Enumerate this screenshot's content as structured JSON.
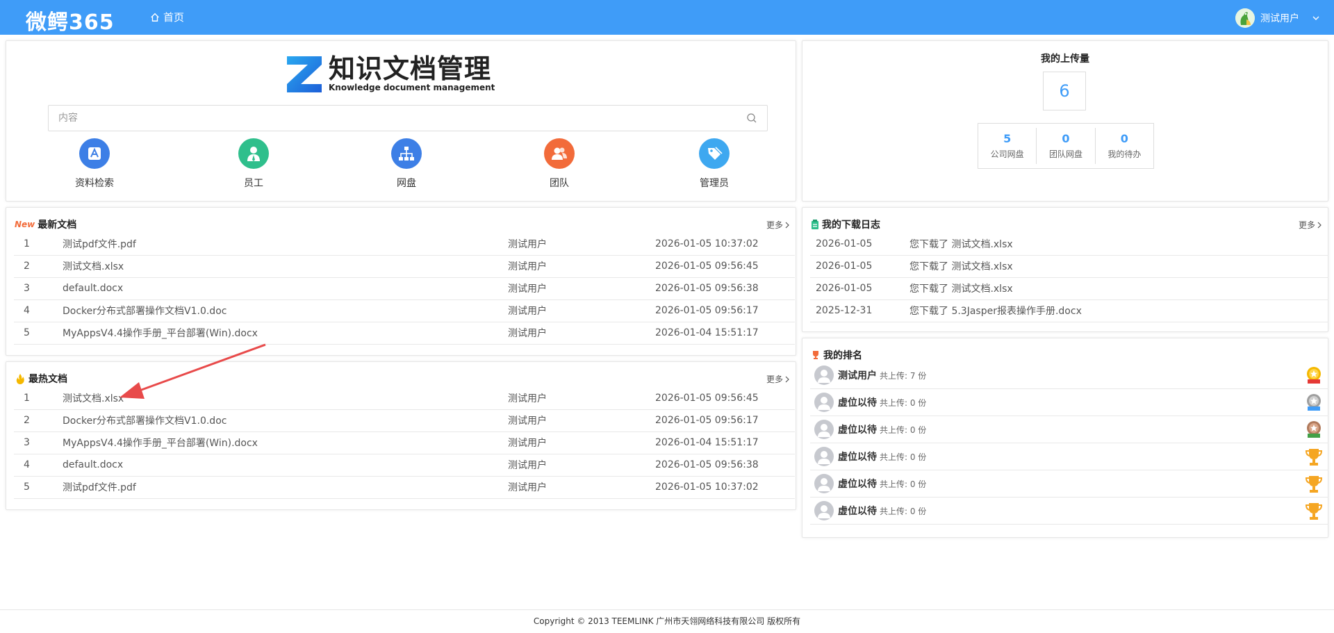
{
  "topbar": {
    "brand": "微鳄365",
    "home_label": "首页",
    "user_name": "测试用户"
  },
  "hero": {
    "logo_cn": "知识文档管理",
    "logo_en": "Knowledge document management",
    "search_placeholder": "内容",
    "quick_links": [
      {
        "label": "资料检索",
        "icon": "search-doc-icon",
        "color": "#3d7fe6"
      },
      {
        "label": "员工",
        "icon": "employee-icon",
        "color": "#2fbf8c"
      },
      {
        "label": "网盘",
        "icon": "network-drive-icon",
        "color": "#3d7fe6"
      },
      {
        "label": "团队",
        "icon": "team-icon",
        "color": "#f26b3a"
      },
      {
        "label": "管理员",
        "icon": "admin-tag-icon",
        "color": "#3ea8f0"
      }
    ]
  },
  "uploads": {
    "title": "我的上传量",
    "total": "6",
    "stats": [
      {
        "value": "5",
        "label": "公司网盘"
      },
      {
        "value": "0",
        "label": "团队网盘"
      },
      {
        "value": "0",
        "label": "我的待办"
      }
    ]
  },
  "latest_docs": {
    "badge": "New",
    "title": "最新文档",
    "more": "更多",
    "rows": [
      {
        "idx": "1",
        "name": "测试pdf文件.pdf",
        "user": "测试用户",
        "time": "2026-01-05 10:37:02"
      },
      {
        "idx": "2",
        "name": "测试文档.xlsx",
        "user": "测试用户",
        "time": "2026-01-05 09:56:45"
      },
      {
        "idx": "3",
        "name": "default.docx",
        "user": "测试用户",
        "time": "2026-01-05 09:56:38"
      },
      {
        "idx": "4",
        "name": "Docker分布式部署操作文档V1.0.doc",
        "user": "测试用户",
        "time": "2026-01-05 09:56:17"
      },
      {
        "idx": "5",
        "name": "MyAppsV4.4操作手册_平台部署(Win).docx",
        "user": "测试用户",
        "time": "2026-01-04 15:51:17"
      }
    ]
  },
  "hot_docs": {
    "title": "最热文档",
    "more": "更多",
    "rows": [
      {
        "idx": "1",
        "name": "测试文档.xlsx",
        "user": "测试用户",
        "time": "2026-01-05 09:56:45"
      },
      {
        "idx": "2",
        "name": "Docker分布式部署操作文档V1.0.doc",
        "user": "测试用户",
        "time": "2026-01-05 09:56:17"
      },
      {
        "idx": "3",
        "name": "MyAppsV4.4操作手册_平台部署(Win).docx",
        "user": "测试用户",
        "time": "2026-01-04 15:51:17"
      },
      {
        "idx": "4",
        "name": "default.docx",
        "user": "测试用户",
        "time": "2026-01-05 09:56:38"
      },
      {
        "idx": "5",
        "name": "测试pdf文件.pdf",
        "user": "测试用户",
        "time": "2026-01-05 10:37:02"
      }
    ]
  },
  "download_log": {
    "title": "我的下载日志",
    "more": "更多",
    "rows": [
      {
        "date": "2026-01-05",
        "text": "您下载了 测试文档.xlsx"
      },
      {
        "date": "2026-01-05",
        "text": "您下载了 测试文档.xlsx"
      },
      {
        "date": "2026-01-05",
        "text": "您下载了 测试文档.xlsx"
      },
      {
        "date": "2025-12-31",
        "text": "您下载了 5.3Jasper报表操作手册.docx"
      }
    ]
  },
  "ranking": {
    "title": "我的排名",
    "rows": [
      {
        "name": "测试用户",
        "count": "共上传: 7 份",
        "medal": "gold-medal-icon"
      },
      {
        "name": "虚位以待",
        "count": "共上传: 0 份",
        "medal": "silver-medal-icon"
      },
      {
        "name": "虚位以待",
        "count": "共上传: 0 份",
        "medal": "bronze-medal-icon"
      },
      {
        "name": "虚位以待",
        "count": "共上传: 0 份",
        "medal": "trophy-icon"
      },
      {
        "name": "虚位以待",
        "count": "共上传: 0 份",
        "medal": "trophy-icon"
      },
      {
        "name": "虚位以待",
        "count": "共上传: 0 份",
        "medal": "trophy-icon"
      }
    ]
  },
  "footer": {
    "text": "Copyright © 2013 TEEMLINK 广州市天翎网络科技有限公司 版权所有"
  },
  "colors": {
    "topbar": "#3f9cf8",
    "accent": "#3f9cf8",
    "arrow": "#e84a4a"
  }
}
